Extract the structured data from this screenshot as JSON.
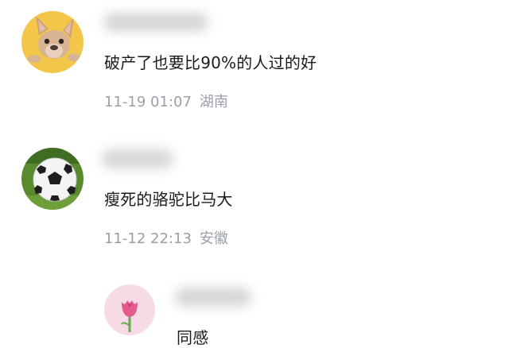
{
  "comments": [
    {
      "avatar_icon": "french-bulldog-avatar",
      "avatar_bg": "#f3c64a",
      "text": "破产了也要比90%的人过的好",
      "time": "11-19 01:07",
      "location": "湖南"
    },
    {
      "avatar_icon": "soccer-ball-avatar",
      "avatar_bg": "#5a8a2e",
      "text": "瘦死的骆驼比马大",
      "time": "11-12 22:13",
      "location": "安徽"
    }
  ],
  "reply": {
    "avatar_icon": "tulip-avatar",
    "avatar_bg": "#f6dbe6",
    "text": "同感"
  }
}
